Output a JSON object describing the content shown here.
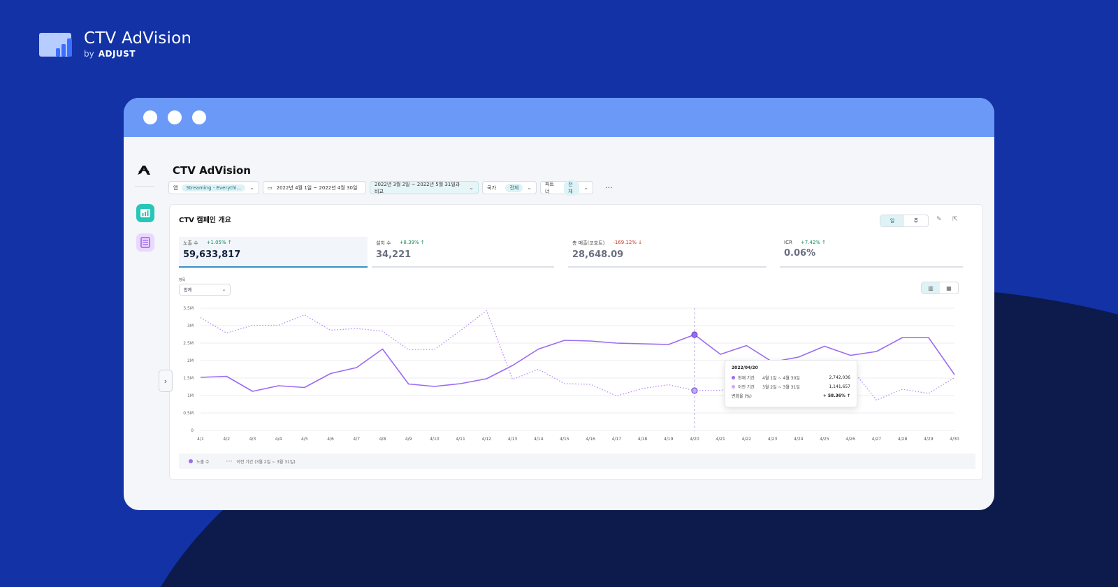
{
  "brand": {
    "title": "CTV AdVision",
    "by": "by",
    "company": "ADJUST"
  },
  "app": {
    "title": "CTV AdVision"
  },
  "filters": {
    "app_label": "앱",
    "app_value": "Streaming - Everythi...",
    "date_range": "2022년 4월 1일 ~ 2022년 4월 30일",
    "compare_range": "2022년 3월 2일 ~ 2022년 5월 31일과 비교",
    "country_label": "국가",
    "country_value": "전체",
    "partner_label": "파트너",
    "partner_value": "전체",
    "more": "···"
  },
  "card": {
    "title": "CTV 캠페인 개요",
    "toggle_day": "일",
    "toggle_week": "주",
    "item_label": "항목",
    "item_value": "합계"
  },
  "kpis": [
    {
      "label": "노출 수",
      "change": "+1.05% ↑",
      "value": "59,633,817"
    },
    {
      "label": "설치 수",
      "change": "+8.39% ↑",
      "value": "34,221"
    },
    {
      "label": "총 매출(코호트)",
      "change": "-169.12% ↓",
      "value": "28,648.09"
    },
    {
      "label": "ICR",
      "change": "+7.42% ↑",
      "value": "0.06%"
    }
  ],
  "legend": {
    "current": "노출 수",
    "previous": "이전 기간 (3월 2일 ~ 3월 31일)"
  },
  "tooltip": {
    "date": "2022/04/20",
    "current_label": "현재 기간",
    "current_range": "4월 1일 ~ 4월 30일",
    "current_value": "2,742,036",
    "previous_label": "이전 기간",
    "previous_range": "3월 2일 ~ 3월 31일",
    "previous_value": "1,141,657",
    "change_label": "변화율 (%)",
    "change_value": "+ 58.36% ↑"
  },
  "colors": {
    "background": "#1232a6",
    "window_bar": "#6b99f8",
    "series": "#9b6bf2",
    "accent": "#26c7b8"
  },
  "chart_data": {
    "type": "line",
    "x": [
      "4/1",
      "4/2",
      "4/3",
      "4/4",
      "4/5",
      "4/6",
      "4/7",
      "4/8",
      "4/9",
      "4/10",
      "4/11",
      "4/12",
      "4/13",
      "4/14",
      "4/15",
      "4/16",
      "4/17",
      "4/18",
      "4/19",
      "4/20",
      "4/21",
      "4/22",
      "4/23",
      "4/24",
      "4/25",
      "4/26",
      "4/27",
      "4/28",
      "4/29",
      "4/30"
    ],
    "series": [
      {
        "name": "노출 수",
        "style": "solid",
        "values": [
          1520000,
          1550000,
          1120000,
          1280000,
          1230000,
          1630000,
          1800000,
          2330000,
          1330000,
          1260000,
          1340000,
          1480000,
          1860000,
          2330000,
          2580000,
          2560000,
          2500000,
          2480000,
          2460000,
          2742036,
          2180000,
          2430000,
          1960000,
          2100000,
          2410000,
          2150000,
          2260000,
          2660000,
          2660000,
          1600000
        ]
      },
      {
        "name": "이전 기간 (3월 2일 ~ 3월 31일)",
        "style": "dotted",
        "values": [
          3230000,
          2790000,
          3010000,
          3010000,
          3310000,
          2870000,
          2920000,
          2840000,
          2310000,
          2320000,
          2860000,
          3430000,
          1460000,
          1750000,
          1340000,
          1320000,
          990000,
          1200000,
          1310000,
          1141657,
          1150000,
          1230000,
          1300000,
          1350000,
          1400000,
          1800000,
          870000,
          1180000,
          1060000,
          1510000
        ]
      }
    ],
    "ylim": [
      0,
      3500000
    ],
    "yticks": [
      "0",
      "0.5M",
      "1M",
      "1.5M",
      "2M",
      "2.5M",
      "3M",
      "3.5M"
    ],
    "grid": true,
    "legend": "bottom-left",
    "highlight_index": 19
  }
}
